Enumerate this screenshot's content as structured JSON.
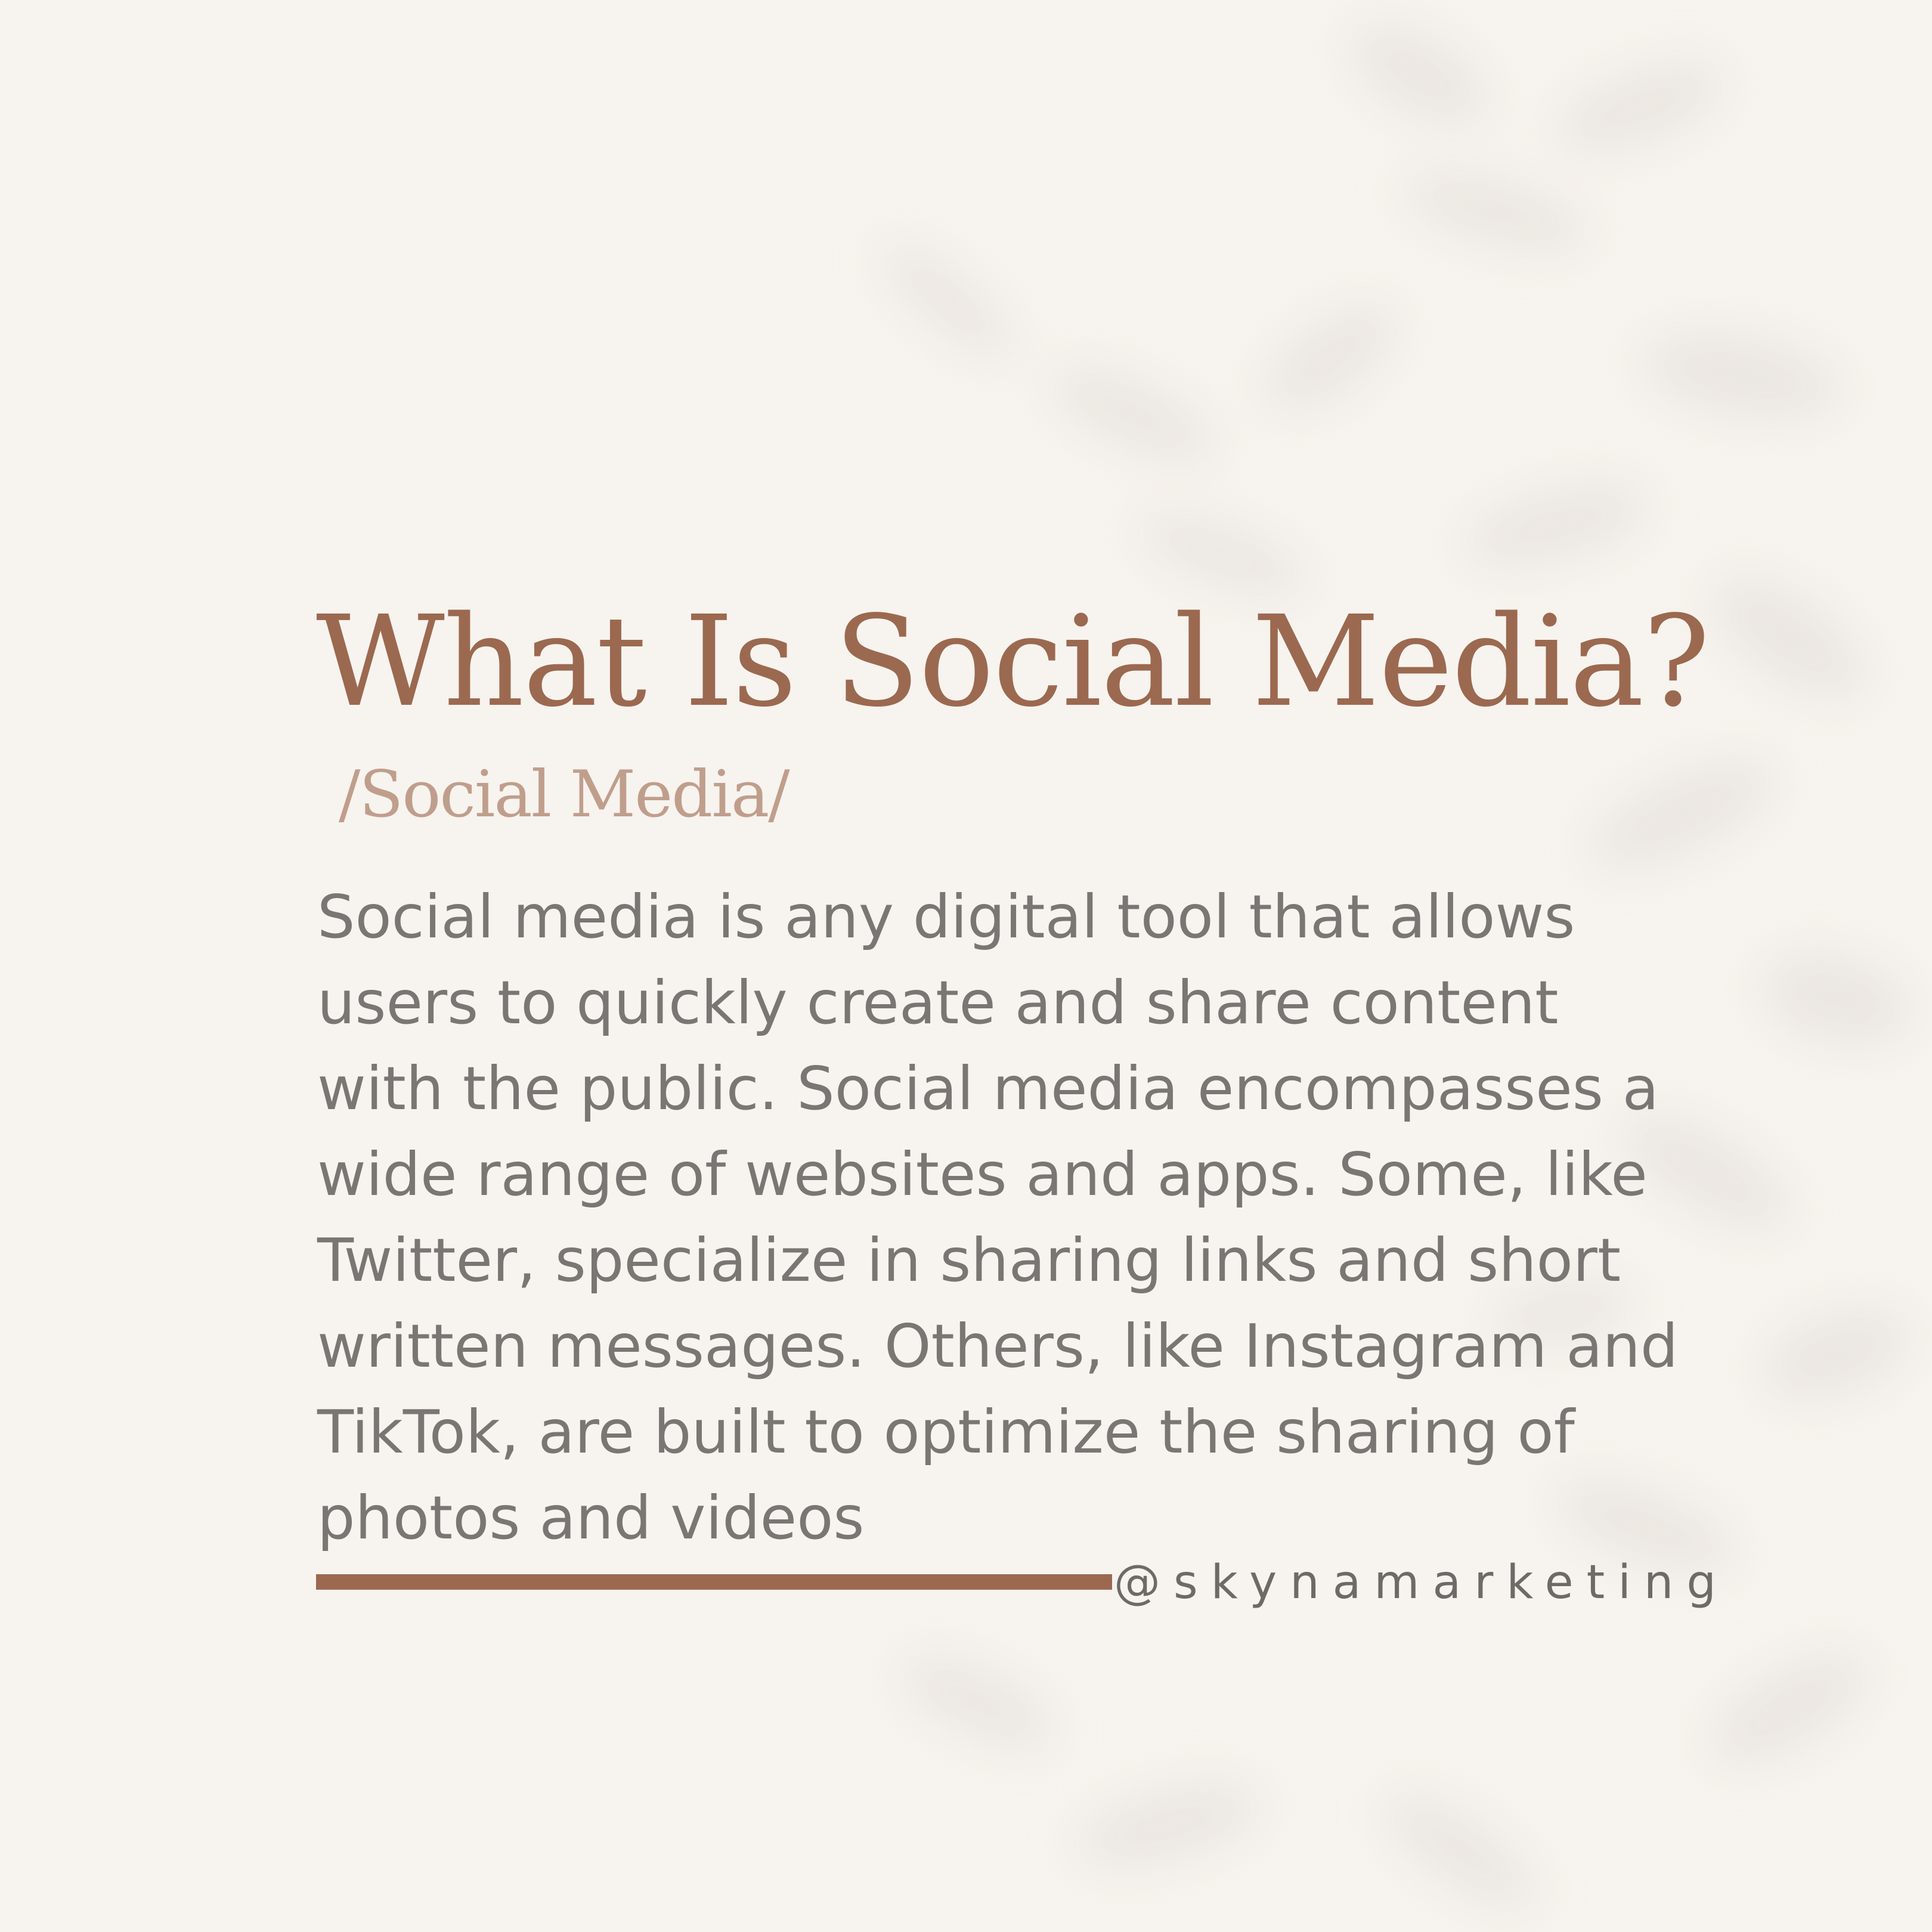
{
  "post": {
    "title": "What Is Social Media?",
    "phonetic": "/Social Media/",
    "body": "Social media is any digital tool that allows\nusers to quickly create and share content\nwith the public. Social media encompasses a\nwide range of websites and apps. Some, like\nTwitter, specialize in sharing links and short\nwritten messages. Others, like Instagram and\nTikTok, are built to optimize the sharing of\nphotos and videos",
    "handle": "@skynamarketing"
  },
  "colors": {
    "background": "#f7f3ee",
    "accent": "#9b6950",
    "phonetic": "#c09e8c",
    "body_text": "#7a7673",
    "shadow": "#e8e4de"
  }
}
